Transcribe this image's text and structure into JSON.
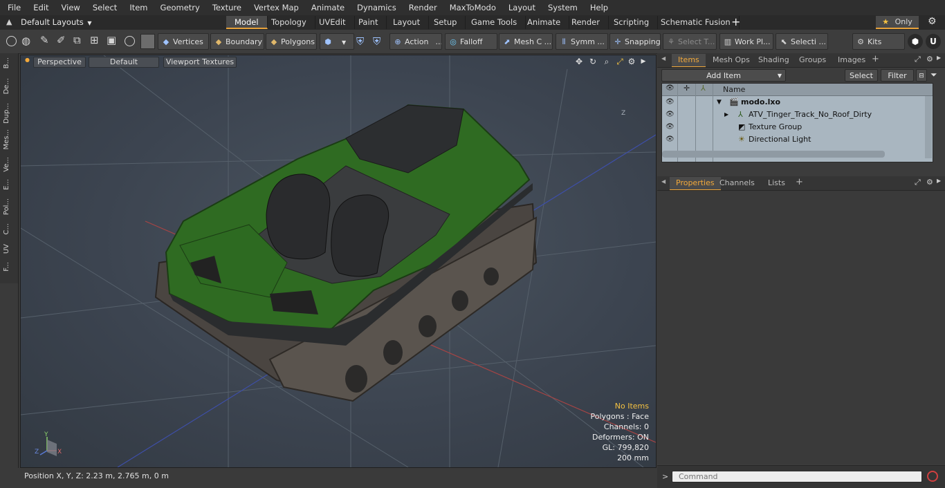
{
  "menu": [
    "File",
    "Edit",
    "View",
    "Select",
    "Item",
    "Geometry",
    "Texture",
    "Vertex Map",
    "Animate",
    "Dynamics",
    "Render",
    "MaxToModo",
    "Layout",
    "System",
    "Help"
  ],
  "layout_select": "Default Layouts",
  "tabs": [
    "Model",
    "Topology",
    "UVEdit",
    "Paint",
    "Layout",
    "Setup",
    "Game Tools",
    "Animate",
    "Render",
    "Scripting",
    "Schematic Fusion"
  ],
  "active_tab": "Model",
  "only_label": "Only",
  "toolbar": {
    "vertices": "Vertices",
    "boundary": "Boundary",
    "polygons": "Polygons",
    "action": "Action",
    "falloff": "Falloff",
    "mesh_c": "Mesh C ...",
    "symm": "Symm ...",
    "snapping": "Snapping",
    "select_t": "Select T...",
    "work_pl": "Work Pl...",
    "selecti": "Selecti ...",
    "kits": "Kits"
  },
  "left_tabs": [
    "B...",
    "De...",
    "Dup...",
    "Mes...",
    "Ve...",
    "E...",
    "Pol...",
    "C...",
    "UV",
    "F..."
  ],
  "viewport": {
    "view": "Perspective",
    "shading": "Default",
    "textures": "Viewport Textures",
    "info": {
      "no_items": "No Items",
      "polygons": "Polygons : Face",
      "channels": "Channels: 0",
      "deformers": "Deformers: ON",
      "gl": "GL: 799,820",
      "scale": "200 mm"
    },
    "axis_labels": {
      "y": "Y",
      "z": "Z",
      "x": "X"
    },
    "corner_label": "Z"
  },
  "status": {
    "position": "Position X, Y, Z:   2.23 m, 2.765 m, 0 m"
  },
  "items_panel": {
    "tabs": [
      "Items",
      "Mesh Ops",
      "Shading",
      "Groups",
      "Images"
    ],
    "active_tab": "Items",
    "add_item": "Add Item",
    "select": "Select",
    "filter": "Filter",
    "column_name": "Name",
    "tree": [
      {
        "label": "modo.lxo",
        "level": 0,
        "bold": true
      },
      {
        "label": "ATV_Tinger_Track_No_Roof_Dirty",
        "level": 1,
        "bold": false
      },
      {
        "label": "Texture Group",
        "level": 1,
        "bold": false
      },
      {
        "label": "Directional Light",
        "level": 1,
        "bold": false
      }
    ]
  },
  "properties_panel": {
    "tabs": [
      "Properties",
      "Channels",
      "Lists"
    ],
    "active_tab": "Properties"
  },
  "command": {
    "placeholder": "Command",
    "prompt": ">"
  },
  "colors": {
    "accent": "#f2a93b",
    "vehicle_body": "#2f6b22",
    "vehicle_dark": "#2a2c2e",
    "viewport_bg": "#3c4450"
  }
}
